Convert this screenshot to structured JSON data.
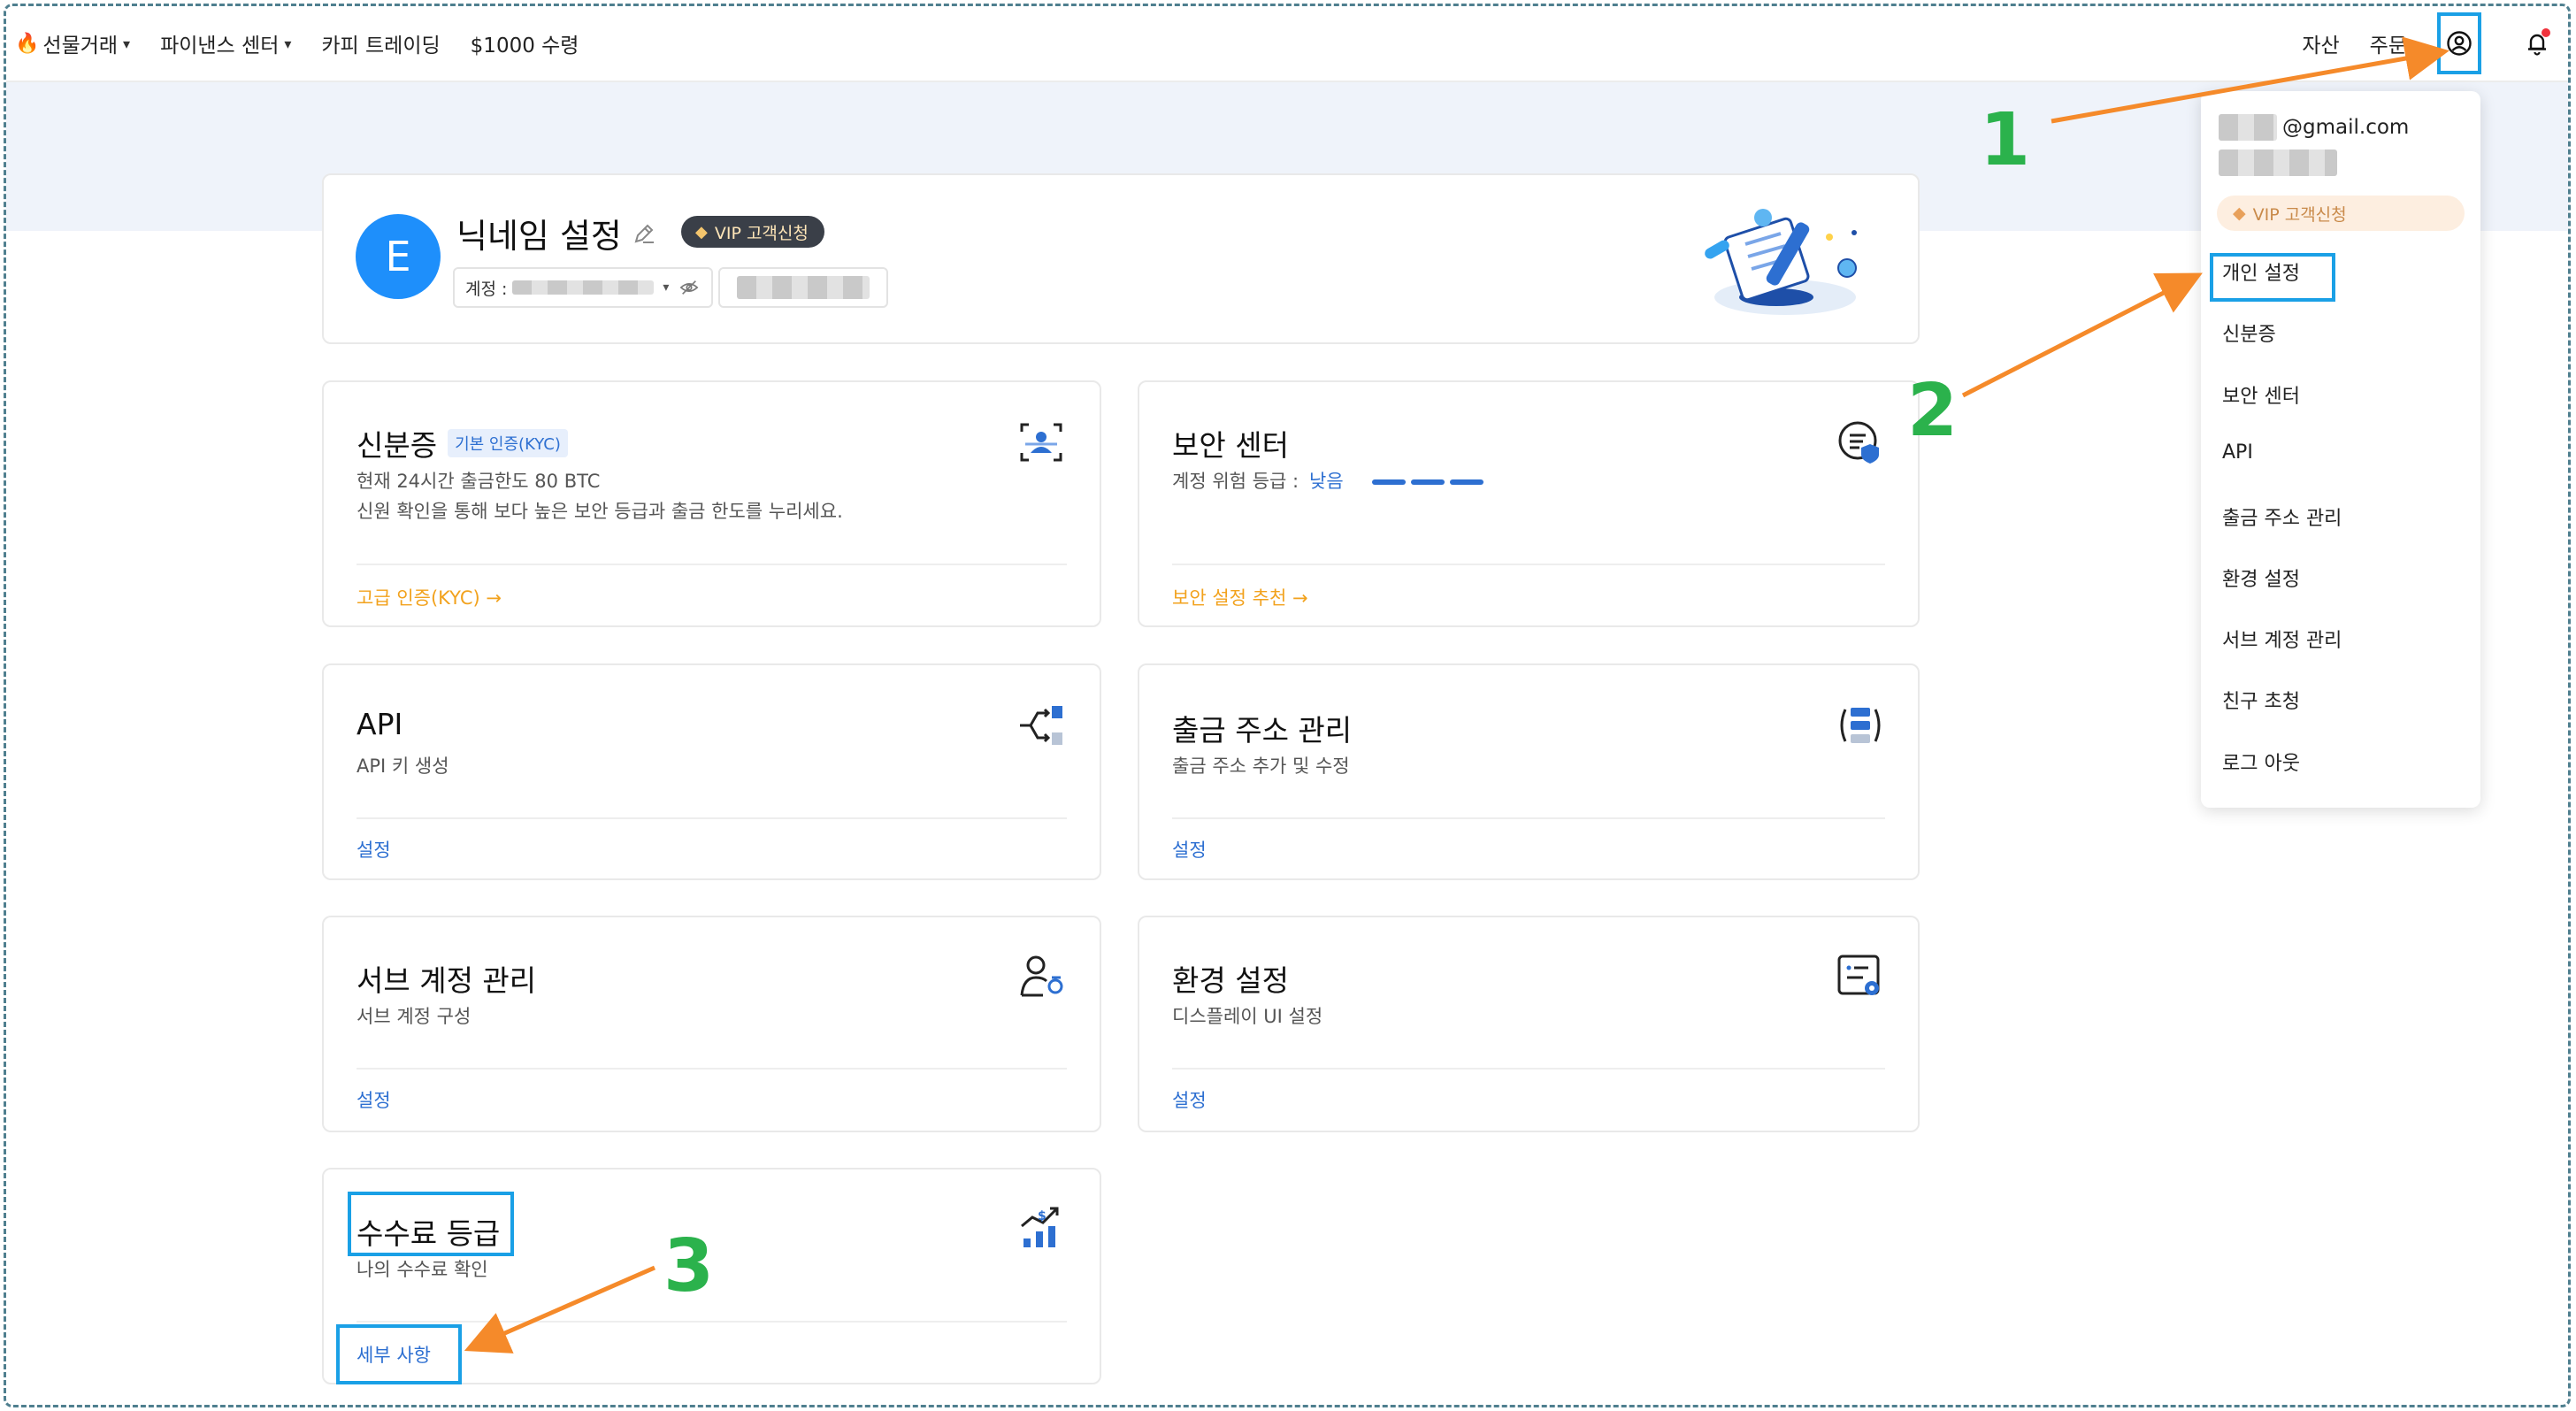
{
  "nav": {
    "futures": "선물거래",
    "finance": "파이낸스 센터",
    "copy": "카피 트레이딩",
    "reward": "$1000 수령",
    "assets": "자산",
    "orders": "주문"
  },
  "profile": {
    "avatar_letter": "E",
    "nickname": "닉네임 설정",
    "vip_badge": "VIP 고객신청",
    "account_label": "계정 : "
  },
  "cards": {
    "kyc": {
      "title": "신분증",
      "tag": "기본 인증(KYC)",
      "desc1": "현재 24시간 출금한도 80 BTC",
      "desc2": "신원 확인을 통해 보다 높은 보안 등급과 출금 한도를 누리세요.",
      "link": "고급 인증(KYC) →"
    },
    "security": {
      "title": "보안 센터",
      "risk_label": "계정 위험 등급 :",
      "risk_value": "낮음",
      "link": "보안 설정 추천 →"
    },
    "api": {
      "title": "API",
      "desc": "API 키 생성",
      "link": "설정"
    },
    "withdraw": {
      "title": "출금 주소 관리",
      "desc": "출금 주소 추가 및 수정",
      "link": "설정"
    },
    "sub": {
      "title": "서브 계정 관리",
      "desc": "서브 계정 구성",
      "link": "설정"
    },
    "prefs": {
      "title": "환경 설정",
      "desc": "디스플레이 UI 설정",
      "link": "설정"
    },
    "fee": {
      "title": "수수료 등급",
      "desc": "나의 수수료 확인",
      "link": "세부 사항"
    }
  },
  "dropdown": {
    "email": "@gmail.com",
    "vip": "VIP 고객신청",
    "items": [
      "개인 설정",
      "신분증",
      "보안 센터",
      "API",
      "출금 주소 관리",
      "환경 설정",
      "서브 계정 관리",
      "친구 초청",
      "로그 아웃"
    ]
  },
  "annotations": {
    "n1": "1",
    "n2": "2",
    "n3": "3"
  },
  "colors": {
    "accent_blue": "#2d6fd1",
    "highlight": "#1aa0e6",
    "orange_link": "#f2a21d",
    "annotation_green": "#2bb24c",
    "arrow_orange": "#f58a2a"
  }
}
